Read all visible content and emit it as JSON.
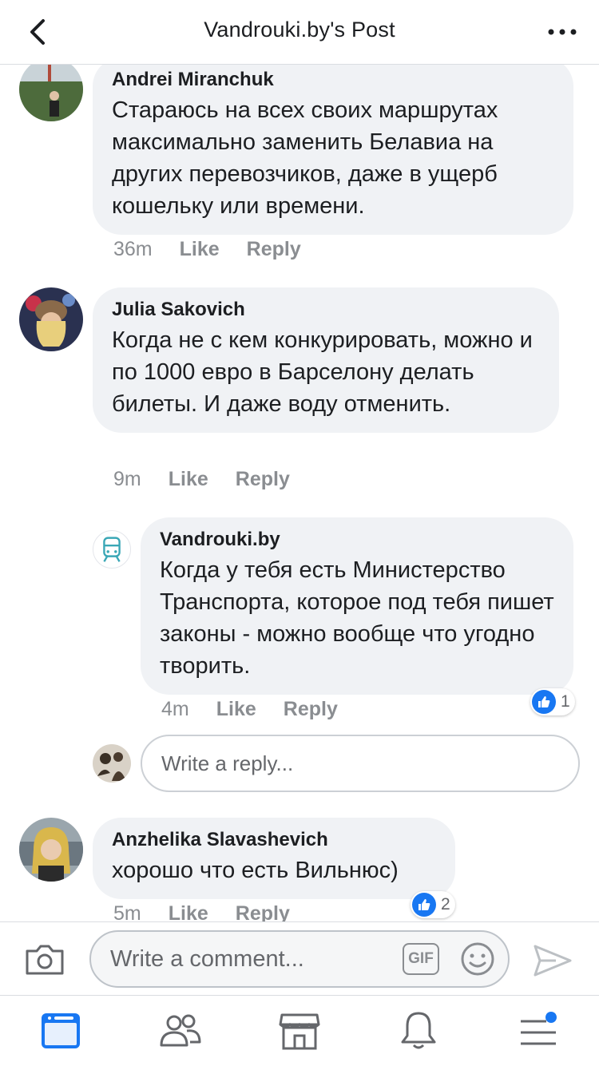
{
  "header": {
    "title": "Vandrouki.by's Post"
  },
  "comments": [
    {
      "author": "Andrei Miranchuk",
      "text": "Стараюсь на всех своих маршрутах максимально заменить Белавиа на других перевозчиков, даже в ущерб кошельку или времени.",
      "time": "36m",
      "like": "Like",
      "reply": "Reply"
    },
    {
      "author": "Julia Sakovich",
      "text": "Когда не с кем конкурировать, можно и по 1000 евро в Барселону делать билеты. И даже воду отменить.",
      "time": "9m",
      "like": "Like",
      "reply": "Reply",
      "replies": [
        {
          "author": "Vandrouki.by",
          "text": "Когда у тебя есть Министерство Транспорта, которое под тебя пишет законы - можно вообще что угодно творить.",
          "time": "4m",
          "like": "Like",
          "reply": "Reply",
          "reaction_count": "1"
        }
      ],
      "reply_placeholder": "Write a reply..."
    },
    {
      "author": "Anzhelika Slavashevich",
      "text": "хорошо что есть Вильнюс)",
      "time": "5m",
      "like": "Like",
      "reply": "Reply",
      "reaction_count": "2"
    }
  ],
  "comment_bar": {
    "placeholder": "Write a comment...",
    "gif_label": "GIF"
  },
  "tabs": [
    {
      "icon": "news-feed-icon",
      "active": true
    },
    {
      "icon": "friends-icon",
      "active": false
    },
    {
      "icon": "marketplace-icon",
      "active": false
    },
    {
      "icon": "notifications-icon",
      "active": false
    },
    {
      "icon": "menu-icon",
      "active": false,
      "badge_dot": true
    }
  ],
  "colors": {
    "accent": "#1877f2",
    "bubble": "#f0f2f5",
    "meta": "#8a8d91",
    "icon": "#65676b"
  }
}
